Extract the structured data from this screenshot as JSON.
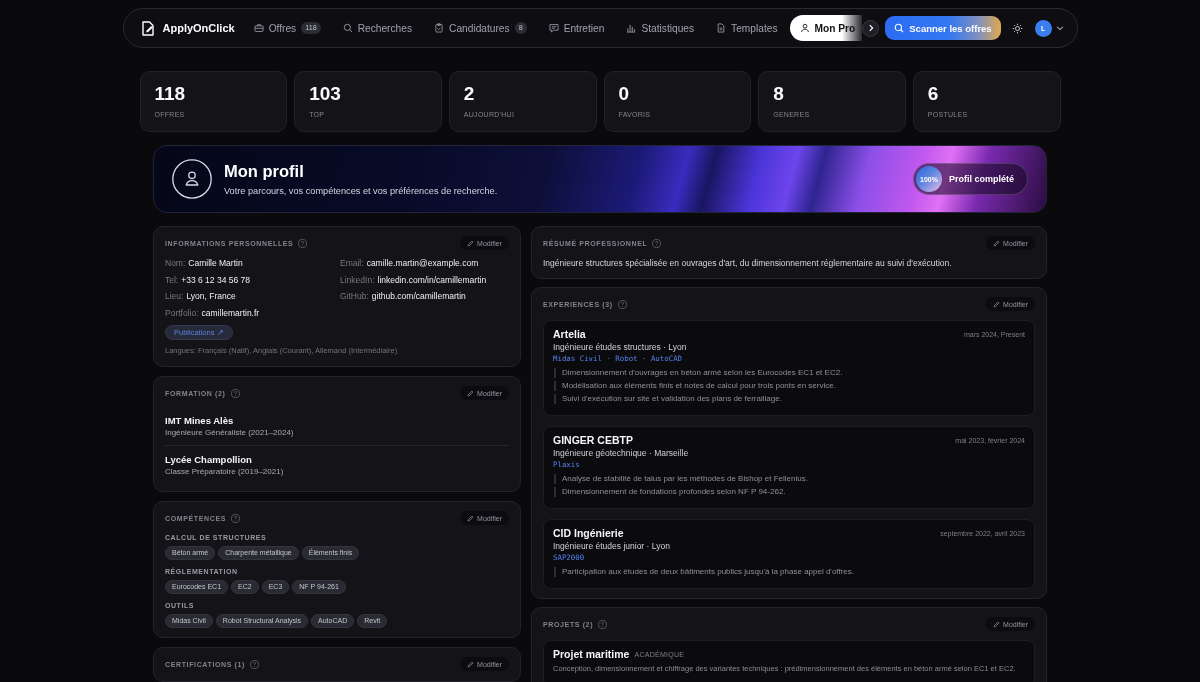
{
  "nav": {
    "brand": "ApplyOnClick",
    "items": [
      {
        "label": "Offres",
        "badge": "118",
        "selected": false
      },
      {
        "label": "Recherches",
        "selected": false
      },
      {
        "label": "Candidatures",
        "badge": "8",
        "selected": false
      },
      {
        "label": "Entretien",
        "selected": false
      },
      {
        "label": "Statistiques",
        "selected": false
      },
      {
        "label": "Templates",
        "selected": false
      },
      {
        "label": "Mon Pro",
        "selected": true
      }
    ],
    "scan_button": "Scanner les offres",
    "avatar": "L"
  },
  "stats": [
    {
      "value": "118",
      "label": "OFFRES"
    },
    {
      "value": "103",
      "label": "TOP"
    },
    {
      "value": "2",
      "label": "AUJOURD'HUI"
    },
    {
      "value": "0",
      "label": "FAVORIS"
    },
    {
      "value": "8",
      "label": "GENERES"
    },
    {
      "value": "6",
      "label": "POSTULES"
    }
  ],
  "banner": {
    "title": "Mon profil",
    "subtitle": "Votre parcours, vos compétences et vos préférences de recherche.",
    "completion": {
      "percent": "100%",
      "label": "Profil complété"
    }
  },
  "left_column": [
    {
      "kind": "info",
      "title": "INFORMATIONS PERSONNELLES",
      "edit": "Modifier",
      "fields": [
        {
          "label": "Nom:",
          "value": "Camille Martin"
        },
        {
          "label": "Email:",
          "value": "camille.martin@example.com"
        },
        {
          "label": "Tel:",
          "value": "+33 6 12 34 56 78"
        },
        {
          "label": "LinkedIn:",
          "value": "linkedin.com/in/camillemartin"
        },
        {
          "label": "Lieu:",
          "value": "Lyon, France"
        },
        {
          "label": "GitHub:",
          "value": "github.com/camillemartin"
        },
        {
          "label": "Portfolio:",
          "value": "camillemartin.fr"
        }
      ],
      "link": "Publications ↗",
      "languages": "Langues: Français (Natif), Anglais (Courant), Allemand (Intermédiaire)"
    },
    {
      "kind": "education",
      "title": "FORMATION (2)",
      "edit": "Modifier",
      "entries": [
        {
          "school": "IMT Mines Alès",
          "degree": "Ingénieure Généraliste (2021–2024)"
        },
        {
          "school": "Lycée Champollion",
          "degree": "Classe Préparatoire (2019–2021)"
        }
      ]
    },
    {
      "kind": "skills",
      "title": "COMPÉTENCES",
      "edit": "Modifier",
      "groups": [
        {
          "name": "CALCUL DE STRUCTURES",
          "tags": [
            "Béton armé",
            "Charpente métallique",
            "Éléments finis"
          ]
        },
        {
          "name": "RÉGLEMENTATION",
          "tags": [
            "Eurocodes EC1",
            "EC2",
            "EC3",
            "NF P 94-261"
          ]
        },
        {
          "name": "OUTILS",
          "tags": [
            "Midas Civil",
            "Robot Structural Analysis",
            "AutoCAD",
            "Revit"
          ]
        }
      ]
    },
    {
      "kind": "certifications",
      "title": "CERTIFICATIONS (1)",
      "edit": "Modifier"
    }
  ],
  "right_column": [
    {
      "kind": "summary",
      "title": "RÉSUMÉ PROFESSIONNEL",
      "edit": "Modifier",
      "text": "Ingénieure structures spécialisée en ouvrages d'art, du dimensionnement réglementaire au suivi d'exécution."
    },
    {
      "kind": "experiences",
      "title": "EXPERIENCES (3)",
      "edit": "Modifier",
      "entries": [
        {
          "company": "Artelia",
          "dates": "mars 2024, Present",
          "role": "Ingénieure études structures · Lyon",
          "tech": "Midas Civil · Robot · AutoCAD",
          "bullets": [
            "Dimensionnement d'ouvrages en béton armé selon les Eurocodes EC1 et EC2.",
            "Modélisation aux éléments finis et notes de calcul pour trois ponts en service.",
            "Suivi d'exécution sur site et validation des plans de ferraillage."
          ]
        },
        {
          "company": "GINGER CEBTP",
          "dates": "mai 2023, février 2024",
          "role": "Ingénieure géotechnique · Marseille",
          "tech": "Plaxis",
          "bullets": [
            "Analyse de stabilité de talus par les méthodes de Bishop et Fellenius.",
            "Dimensionnement de fondations profondes selon NF P 94-262."
          ]
        },
        {
          "company": "CID Ingénierie",
          "dates": "septembre 2022, avril 2023",
          "role": "Ingénieure études junior · Lyon",
          "tech": "SAP2000",
          "bullets": [
            "Participation aux études de deux bâtiments publics jusqu'à la phase appel d'offres."
          ]
        }
      ]
    },
    {
      "kind": "projects",
      "title": "PROJETS (2)",
      "edit": "Modifier",
      "entries": [
        {
          "name": "Projet maritime",
          "tag": "ACADÉMIQUE",
          "description": "Conception, dimensionnement et chiffrage des variantes techniques : prédimensionnement des éléments en béton armé selon EC1 et EC2."
        }
      ]
    }
  ]
}
